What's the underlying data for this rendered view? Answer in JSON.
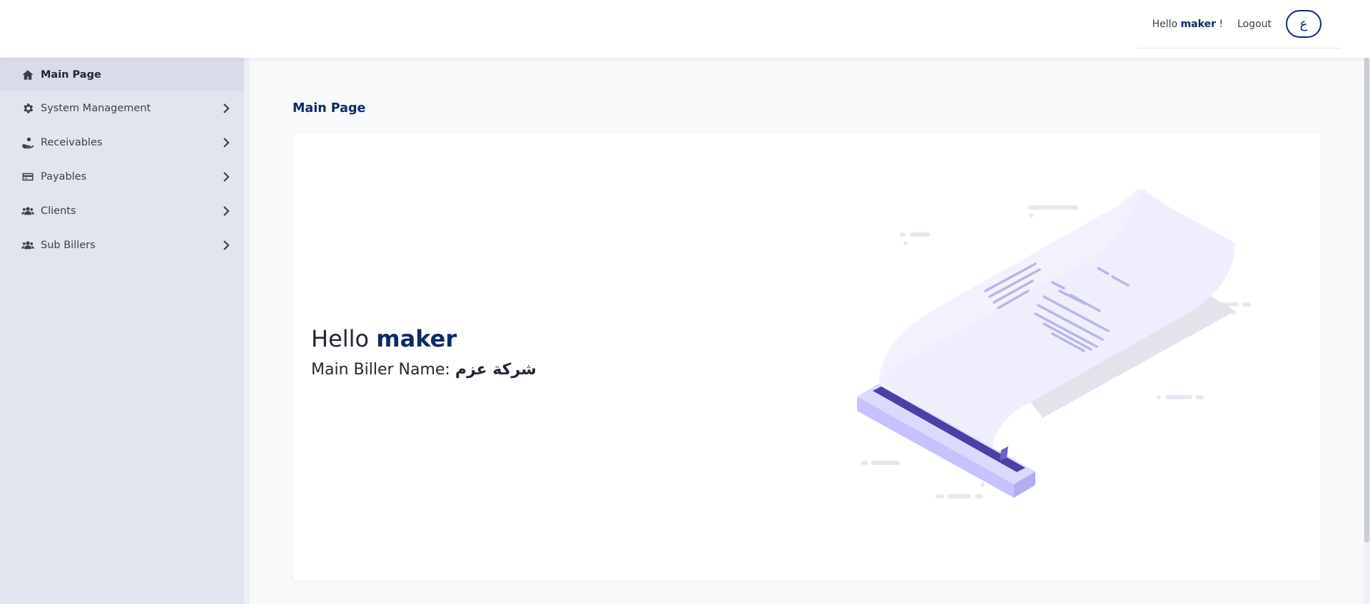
{
  "header": {
    "greeting_prefix": "Hello",
    "username": "maker",
    "greeting_suffix": "!",
    "logout_label": "Logout",
    "language_toggle": "ع"
  },
  "sidebar": {
    "items": [
      {
        "label": "Main Page",
        "icon": "home-icon",
        "active": true
      },
      {
        "label": "System Management",
        "icon": "gear-icon",
        "active": false
      },
      {
        "label": "Receivables",
        "icon": "hand-coin-icon",
        "active": false
      },
      {
        "label": "Payables",
        "icon": "credit-card-icon",
        "active": false
      },
      {
        "label": "Clients",
        "icon": "users-icon",
        "active": false
      },
      {
        "label": "Sub Billers",
        "icon": "users-icon",
        "active": false
      }
    ]
  },
  "main": {
    "page_title": "Main Page",
    "greeting_word": "Hello",
    "greeting_name": "maker",
    "biller_label": "Main Biller Name:",
    "biller_name": "شركة عزم"
  },
  "colors": {
    "primary": "#0e2a66",
    "sidebar_bg": "#e2e5ef",
    "illustration_accent": "#b9b5f5",
    "illustration_dark": "#4b3fa8"
  }
}
